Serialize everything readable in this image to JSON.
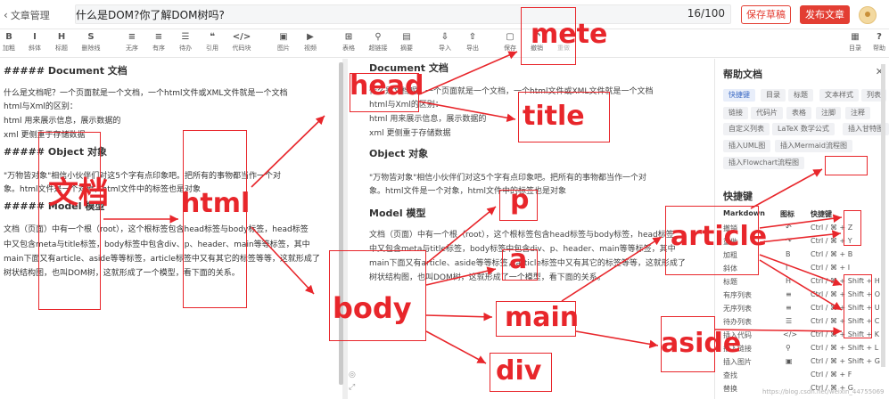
{
  "header": {
    "back_label": "文章管理",
    "title_value": "什么是DOM?你了解DOM树吗?",
    "char_count": "16/100",
    "save_draft": "保存草稿",
    "publish": "发布文章"
  },
  "toolbar": {
    "items": [
      {
        "icon": "B",
        "label": "加粗"
      },
      {
        "icon": "I",
        "label": "斜体"
      },
      {
        "icon": "H",
        "label": "标题"
      },
      {
        "icon": "S",
        "label": "删除线"
      },
      {
        "icon": "≡",
        "label": "无序"
      },
      {
        "icon": "≡",
        "label": "有序"
      },
      {
        "icon": "☰",
        "label": "待办"
      },
      {
        "icon": "❝",
        "label": "引用"
      },
      {
        "icon": "</>",
        "label": "代码块"
      },
      {
        "icon": "▣",
        "label": "图片"
      },
      {
        "icon": "▶",
        "label": "视频"
      },
      {
        "icon": "⊞",
        "label": "表格"
      },
      {
        "icon": "⚲",
        "label": "超链接"
      },
      {
        "icon": "▤",
        "label": "摘要"
      },
      {
        "icon": "⇩",
        "label": "导入"
      },
      {
        "icon": "⇧",
        "label": "导出"
      },
      {
        "icon": "▢",
        "label": "保存"
      },
      {
        "icon": "↶",
        "label": "撤销"
      },
      {
        "icon": "↷",
        "label": "重做"
      },
      {
        "icon": "▦",
        "label": "目录"
      },
      {
        "icon": "?",
        "label": "帮助"
      }
    ]
  },
  "editor": {
    "lines": [
      "##### Document 文档",
      "什么是文档呢？一个页面就是一个文档，一个html文件或XML文件就是一个文档",
      "html与Xml的区别：",
      "html 用来展示信息，展示数据的",
      "xml 更侧重于存储数据",
      "##### Object 对象",
      "\"万物皆对象\"相信小伙伴们对这5个字有点印象吧。把所有的事物都当作一个对",
      "象。html文件是一个对象，html文件中的标签也是对象",
      "##### Model 模型",
      "文档（页面）中有一个根（root），这个根标签包含head标签与body标签，head标签",
      "中又包含meta与title标签，body标签中包含div、p、header、main等等标签，其中",
      "main下面又有article、aside等等标签，article标签中又有其它的标签等等，这就形成了",
      "树状结构图，也叫DOM树，这就形成了一个模型，看下面的关系。"
    ]
  },
  "preview": {
    "h_document": "Document 文档",
    "p1": "什么是文档呢？一个页面就是一个文档，一个html文件或XML文件就是一个文档",
    "p2": "html与Xml的区别：",
    "p3": "html 用来展示信息，展示数据的",
    "p4": "xml 更侧重于存储数据",
    "h_object": "Object 对象",
    "p5": "\"万物皆对象\"相信小伙伴们对这5个字有点印象吧。把所有的事物都当作一个对",
    "p6": "象。html文件是一个对象，html文件中的标签也是对象",
    "h_model": "Model 模型",
    "p7": "文档（页面）中有一个根（root），这个根标签包含head标签与body标签，head标签",
    "p8": "中又包含meta与title标签，body标签中包含div、p、header、main等等标签，其中",
    "p9": "main下面又有article、aside等等标签，article标签中又有其它的标签等等，这就形成了",
    "p10": "树状结构图，也叫DOM树，这就形成了一个模型，看下面的关系。"
  },
  "help": {
    "title": "帮助文档",
    "tags": [
      "快捷键",
      "目录",
      "标题",
      "文本样式",
      "列表",
      "链接",
      "代码片",
      "表格",
      "注脚",
      "注释",
      "自定义列表",
      "LaTeX 数学公式",
      "插入甘特图",
      "插入UML图",
      "插入Mermaid流程图",
      "插入Flowchart流程图"
    ],
    "shortcuts_title": "快捷键",
    "col_markdown": "Markdown",
    "col_icon": "图标",
    "col_key": "快捷键",
    "rows": [
      {
        "name": "撤销",
        "icon": "↶",
        "key": "Ctrl / ⌘ + Z"
      },
      {
        "name": "重做",
        "icon": "↷",
        "key": "Ctrl / ⌘ + Y"
      },
      {
        "name": "加粗",
        "icon": "B",
        "key": "Ctrl / ⌘ + B"
      },
      {
        "name": "斜体",
        "icon": "I",
        "key": "Ctrl / ⌘ + I"
      },
      {
        "name": "标题",
        "icon": "H",
        "key": "Ctrl / ⌘ + Shift + H"
      },
      {
        "name": "有序列表",
        "icon": "≡",
        "key": "Ctrl / ⌘ + Shift + O"
      },
      {
        "name": "无序列表",
        "icon": "≡",
        "key": "Ctrl / ⌘ + Shift + U"
      },
      {
        "name": "待办列表",
        "icon": "☰",
        "key": "Ctrl / ⌘ + Shift + C"
      },
      {
        "name": "插入代码",
        "icon": "</>",
        "key": "Ctrl / ⌘ + Shift + K"
      },
      {
        "name": "插入链接",
        "icon": "⚲",
        "key": "Ctrl / ⌘ + Shift + L"
      },
      {
        "name": "插入图片",
        "icon": "▣",
        "key": "Ctrl / ⌘ + Shift + G"
      },
      {
        "name": "查找",
        "icon": "",
        "key": "Ctrl / ⌘ + F"
      },
      {
        "name": "替换",
        "icon": "",
        "key": "Ctrl / ⌘ + G"
      }
    ]
  },
  "annotations": {
    "color": "#e8262b",
    "labels": {
      "wendang": "文档",
      "html": "html",
      "head": "head",
      "title": "title",
      "mete": "mete",
      "p": "p",
      "a": "a",
      "body": "body",
      "main": "main",
      "div": "div",
      "article": "article",
      "aside": "aside"
    }
  },
  "watermark": "https://blog.csdn.net/weixin_44755069"
}
